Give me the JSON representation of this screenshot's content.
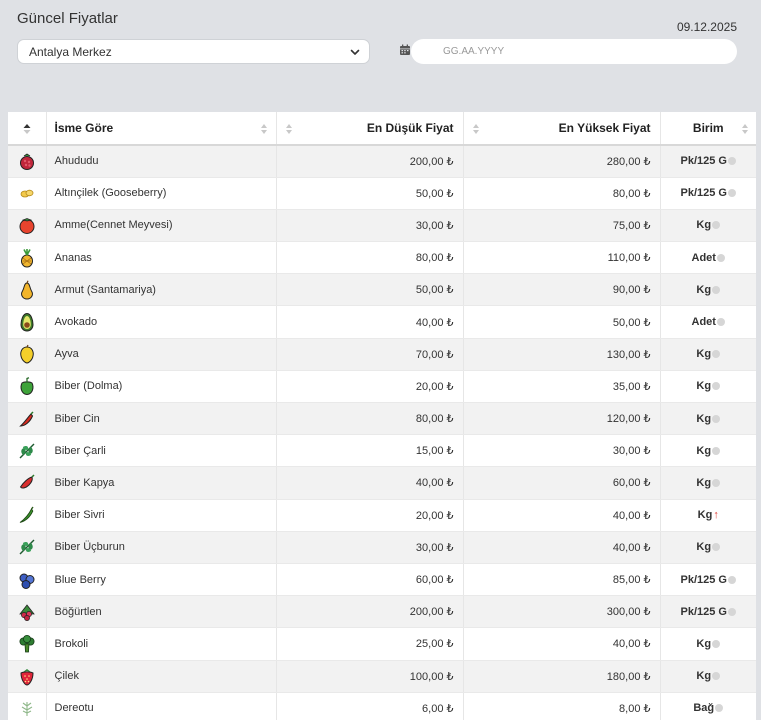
{
  "header": {
    "title": "Güncel Fiyatlar",
    "date": "09.12.2025"
  },
  "filters": {
    "location_selected": "Antalya Merkez",
    "date_placeholder": "GG.AA.YYYY"
  },
  "table": {
    "columns": [
      "İsme Göre",
      "En Düşük Fiyat",
      "En Yüksek Fiyat",
      "Birim"
    ],
    "rows": [
      {
        "icon": "raspberry-icon",
        "name": "Ahududu",
        "min": "200,00 ₺",
        "max": "280,00 ₺",
        "unit": "Pk/125 G",
        "trend": "toggle"
      },
      {
        "icon": "gooseberry-icon",
        "name": "Altınçilek (Gooseberry)",
        "min": "50,00 ₺",
        "max": "80,00 ₺",
        "unit": "Pk/125 G",
        "trend": "toggle"
      },
      {
        "icon": "persimmon-icon",
        "name": "Amme(Cennet Meyvesi)",
        "min": "30,00 ₺",
        "max": "75,00 ₺",
        "unit": "Kg",
        "trend": "toggle"
      },
      {
        "icon": "pineapple-icon",
        "name": "Ananas",
        "min": "80,00 ₺",
        "max": "110,00 ₺",
        "unit": "Adet",
        "trend": "toggle"
      },
      {
        "icon": "pear-icon",
        "name": "Armut (Santamariya)",
        "min": "50,00 ₺",
        "max": "90,00 ₺",
        "unit": "Kg",
        "trend": "toggle"
      },
      {
        "icon": "avocado-icon",
        "name": "Avokado",
        "min": "40,00 ₺",
        "max": "50,00 ₺",
        "unit": "Adet",
        "trend": "toggle"
      },
      {
        "icon": "quince-icon",
        "name": "Ayva",
        "min": "70,00 ₺",
        "max": "130,00 ₺",
        "unit": "Kg",
        "trend": "toggle"
      },
      {
        "icon": "bell-pepper-icon",
        "name": "Biber (Dolma)",
        "min": "20,00 ₺",
        "max": "35,00 ₺",
        "unit": "Kg",
        "trend": "toggle"
      },
      {
        "icon": "chili-pepper-icon",
        "name": "Biber Cin",
        "min": "80,00 ₺",
        "max": "120,00 ₺",
        "unit": "Kg",
        "trend": "toggle"
      },
      {
        "icon": "leaf-pepper-icon",
        "name": "Biber Çarli",
        "min": "15,00 ₺",
        "max": "30,00 ₺",
        "unit": "Kg",
        "trend": "toggle"
      },
      {
        "icon": "red-pepper-icon",
        "name": "Biber Kapya",
        "min": "40,00 ₺",
        "max": "60,00 ₺",
        "unit": "Kg",
        "trend": "toggle"
      },
      {
        "icon": "green-chili-icon",
        "name": "Biber Sivri",
        "min": "20,00 ₺",
        "max": "40,00 ₺",
        "unit": "Kg",
        "trend": "up"
      },
      {
        "icon": "leaf-pepper-icon",
        "name": "Biber Üçburun",
        "min": "30,00 ₺",
        "max": "40,00 ₺",
        "unit": "Kg",
        "trend": "toggle"
      },
      {
        "icon": "blueberry-icon",
        "name": "Blue Berry",
        "min": "60,00 ₺",
        "max": "85,00 ₺",
        "unit": "Pk/125 G",
        "trend": "toggle"
      },
      {
        "icon": "blackberry-icon",
        "name": "Böğürtlen",
        "min": "200,00 ₺",
        "max": "300,00 ₺",
        "unit": "Pk/125 G",
        "trend": "toggle"
      },
      {
        "icon": "broccoli-icon",
        "name": "Brokoli",
        "min": "25,00 ₺",
        "max": "40,00 ₺",
        "unit": "Kg",
        "trend": "toggle"
      },
      {
        "icon": "strawberry-icon",
        "name": "Çilek",
        "min": "100,00 ₺",
        "max": "180,00 ₺",
        "unit": "Kg",
        "trend": "toggle"
      },
      {
        "icon": "dill-icon",
        "name": "Dereotu",
        "min": "6,00 ₺",
        "max": "8,00 ₺",
        "unit": "Bağ",
        "trend": "toggle"
      }
    ]
  },
  "colors": {
    "background": "#dfe1e5",
    "row_alt": "#f2f2f2",
    "trend_up": "#e0433b"
  }
}
